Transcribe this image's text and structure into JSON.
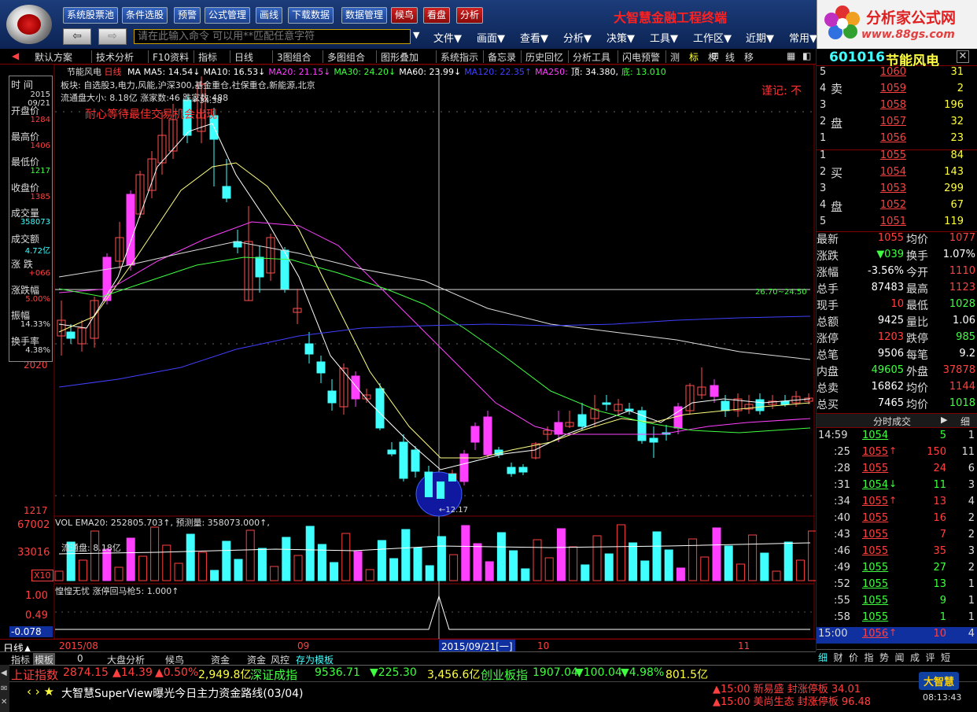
{
  "toolbar": {
    "buttons": [
      "系统股票池",
      "条件选股",
      "预警",
      "公式管理",
      "画线",
      "下载数据",
      "数据管理"
    ],
    "red_buttons": [
      "候鸟",
      "看盘",
      "分析"
    ],
    "app_title": "大智慧金融工程终端",
    "cmd_placeholder": "请在此输入命令   可以用**匹配任意字符",
    "menus": [
      "文件▼",
      "画面▼",
      "查看▼",
      "分析▼",
      "决策▼",
      "工具▼",
      "工作区▼",
      "近期▼",
      "常用▼"
    ],
    "back_icon": "arrow-left-icon",
    "forward_icon": "arrow-right-icon"
  },
  "brand": {
    "name": "分析家公式网",
    "url": "www.88gs.com"
  },
  "toolbar2": [
    "默认方案",
    "技术分析",
    "F10资料",
    "指标",
    "日线",
    "3图组合",
    "多图组合",
    "图形叠加",
    "系统指示",
    "备忘录",
    "历史回忆",
    "分析工具",
    "闪电预警",
    "测",
    "标",
    "权",
    "线",
    "移"
  ],
  "stock": {
    "code": "601016",
    "name": "节能风电"
  },
  "chart_header": {
    "name": "节能风电",
    "period": "日线",
    "ma": [
      {
        "label": "MA MA5: 14.54↓",
        "color": "#ffffff"
      },
      {
        "label": "MA10: 16.53↓",
        "color": "#ffffff"
      },
      {
        "label": "MA20: 21.15↓",
        "color": "#ff40ff"
      },
      {
        "label": "MA30: 24.20↓",
        "color": "#40ff40"
      },
      {
        "label": "MA60: 23.99↓",
        "color": "#ffffff"
      },
      {
        "label": "MA120: 22.35↑",
        "color": "#4040ff"
      },
      {
        "label": "MA250:",
        "color": "#ff40ff"
      },
      {
        "label": "顶: 34.380,",
        "color": "#ffffff"
      },
      {
        "label": "底: 13.010",
        "color": "#40ff40"
      }
    ],
    "sectors": "板块: 自选股3,电力,风能,沪深300,基金重仓,社保重仓,新能源,北京",
    "float": "流通盘大小: 8.18亿   涨家数:46   跌家数:488",
    "note": "耐心等待最佳交易机会出现",
    "warning": "谨记: 不",
    "range_label": "26.70~24.50",
    "low_label": "←12.17",
    "high_label": "←34.38",
    "y_top": "2020",
    "y_bottom": "1217",
    "y_mark": "2020"
  },
  "info_box": [
    {
      "label": "时  间",
      "value": "2015"
    },
    {
      "label": "",
      "value": "09/21"
    },
    {
      "label": "开盘价",
      "value": "1284"
    },
    {
      "label": "最高价",
      "value": "1406"
    },
    {
      "label": "最低价",
      "value": "1217"
    },
    {
      "label": "收盘价",
      "value": "1385"
    },
    {
      "label": "成交量",
      "value": "358073"
    },
    {
      "label": "成交额",
      "value": "4.72亿"
    },
    {
      "label": "涨  跌",
      "value": "+066"
    },
    {
      "label": "涨跌幅",
      "value": "5.00%"
    },
    {
      "label": "振幅",
      "value": "14.33%"
    },
    {
      "label": "换手率",
      "value": "4.38%"
    }
  ],
  "volume": {
    "header": "VOL EMA20: 252805.703↑, 预测量: 358073.000↑,",
    "float": "流通盘: 8.18亿",
    "y_labels": [
      "67002",
      "33016",
      "X10"
    ]
  },
  "indicator": {
    "header": "惶惶无忧  涨停回马枪5: 1.000↑",
    "y_labels": [
      "1.00",
      "0.49",
      "-0.078"
    ]
  },
  "x_axis": {
    "labels": [
      "2015/08",
      "09",
      "2015/09/21[一]",
      "10",
      "11"
    ],
    "period": "日线▲"
  },
  "bottom_tabs": [
    "指标",
    "模板",
    "0",
    "大盘分析",
    "候鸟",
    "资金",
    "资金",
    "风控",
    "存为模板"
  ],
  "order_book": {
    "sell": [
      {
        "n": "5",
        "p": "1060",
        "v": "31"
      },
      {
        "n": "4",
        "p": "1059",
        "v": "2"
      },
      {
        "n": "3",
        "p": "1058",
        "v": "196"
      },
      {
        "n": "2",
        "p": "1057",
        "v": "32"
      },
      {
        "n": "1",
        "p": "1056",
        "v": "23"
      }
    ],
    "buy": [
      {
        "n": "1",
        "p": "1055",
        "v": "84"
      },
      {
        "n": "2",
        "p": "1054",
        "v": "143"
      },
      {
        "n": "3",
        "p": "1053",
        "v": "299"
      },
      {
        "n": "4",
        "p": "1052",
        "v": "67"
      },
      {
        "n": "5",
        "p": "1051",
        "v": "119"
      }
    ],
    "sell_label": [
      "卖",
      "盘"
    ],
    "buy_label": [
      "买",
      "盘"
    ]
  },
  "stats": [
    {
      "l1": "最新",
      "v1": "1055",
      "l2": "均价",
      "v2": "1077",
      "c1": "#ff4040",
      "c2": "#ff4040"
    },
    {
      "l1": "涨跌",
      "v1": "▼039",
      "l2": "换手",
      "v2": "1.07%",
      "c1": "#40ff40",
      "c2": "#ffffff"
    },
    {
      "l1": "涨幅",
      "v1": "-3.56%",
      "l2": "今开",
      "v2": "1110",
      "c1": "#ffffff",
      "c2": "#ff4040"
    },
    {
      "l1": "总手",
      "v1": "87483",
      "l2": "最高",
      "v2": "1123",
      "c1": "#ffffff",
      "c2": "#ff4040"
    },
    {
      "l1": "现手",
      "v1": "10",
      "l2": "最低",
      "v2": "1028",
      "c1": "#ff4040",
      "c2": "#40ff40"
    },
    {
      "l1": "总额",
      "v1": "9425",
      "l2": "量比",
      "v2": "1.06",
      "c1": "#ffffff",
      "c2": "#ffffff"
    },
    {
      "l1": "涨停",
      "v1": "1203",
      "l2": "跌停",
      "v2": "985",
      "c1": "#ff4040",
      "c2": "#40ff40"
    },
    {
      "l1": "总笔",
      "v1": "9506",
      "l2": "每笔",
      "v2": "9.2",
      "c1": "#ffffff",
      "c2": "#ffffff"
    },
    {
      "l1": "内盘",
      "v1": "49605",
      "l2": "外盘",
      "v2": "37878",
      "c1": "#40ff40",
      "c2": "#ff4040"
    },
    {
      "l1": "总卖",
      "v1": "16862",
      "l2": "均价",
      "v2": "1144",
      "c1": "#ffffff",
      "c2": "#ff4040"
    },
    {
      "l1": "总买",
      "v1": "7465",
      "l2": "均价",
      "v2": "1018",
      "c1": "#ffffff",
      "c2": "#40ff40"
    }
  ],
  "ticks_header": "分时成交",
  "ticks_header_btn": "细",
  "ticks": [
    {
      "t": "14:59",
      "p": "1054",
      "v": "5",
      "n": "1",
      "c": "#40ff40",
      "a": ""
    },
    {
      "t": ":25",
      "p": "1055",
      "v": "150",
      "n": "11",
      "c": "#ff4040",
      "a": "↑"
    },
    {
      "t": ":28",
      "p": "1055",
      "v": "24",
      "n": "6",
      "c": "#ff4040",
      "a": ""
    },
    {
      "t": ":31",
      "p": "1054",
      "v": "11",
      "n": "3",
      "c": "#40ff40",
      "a": "↓"
    },
    {
      "t": ":34",
      "p": "1055",
      "v": "13",
      "n": "4",
      "c": "#ff4040",
      "a": "↑"
    },
    {
      "t": ":40",
      "p": "1055",
      "v": "16",
      "n": "2",
      "c": "#ff4040",
      "a": ""
    },
    {
      "t": ":43",
      "p": "1055",
      "v": "7",
      "n": "2",
      "c": "#ff4040",
      "a": ""
    },
    {
      "t": ":46",
      "p": "1055",
      "v": "35",
      "n": "3",
      "c": "#ff4040",
      "a": ""
    },
    {
      "t": ":49",
      "p": "1055",
      "v": "27",
      "n": "2",
      "c": "#40ff40",
      "a": ""
    },
    {
      "t": ":52",
      "p": "1055",
      "v": "13",
      "n": "1",
      "c": "#40ff40",
      "a": ""
    },
    {
      "t": ":55",
      "p": "1055",
      "v": "9",
      "n": "1",
      "c": "#40ff40",
      "a": ""
    },
    {
      "t": ":58",
      "p": "1055",
      "v": "1",
      "n": "1",
      "c": "#40ff40",
      "a": ""
    },
    {
      "t": "15:00",
      "p": "1056",
      "v": "10",
      "n": "4",
      "c": "#ff4040",
      "a": "↑"
    }
  ],
  "right_tabs": [
    "细",
    "财",
    "价",
    "指",
    "势",
    "闻",
    "成",
    "评",
    "短"
  ],
  "status1": {
    "sh_label": "上证指数",
    "sh_val": "2874.15",
    "sh_chg": "▲14.39",
    "sh_pct": "▲0.50%",
    "sh_amt": "2,949.8亿",
    "sz_label": "深证成指",
    "sz_val": "9536.71",
    "sz_chg": "▼225.30",
    "sz_amt": "3,456.6亿",
    "cy_label": "创业板指",
    "cy_val": "1907.04",
    "cy_chg": "▼100.04",
    "cy_pct": "▼4.98%",
    "cy_amt": "801.5亿"
  },
  "status2": {
    "news": "大智慧SuperView曝光今日主力资金路线(03/04)",
    "alert1": "▲15:00 新易盛  封涨停板 34.01",
    "alert2": "▲15:00 美尚生态 封涨停板 96.48",
    "logo": "大智慧",
    "time": "08:13:43"
  }
}
